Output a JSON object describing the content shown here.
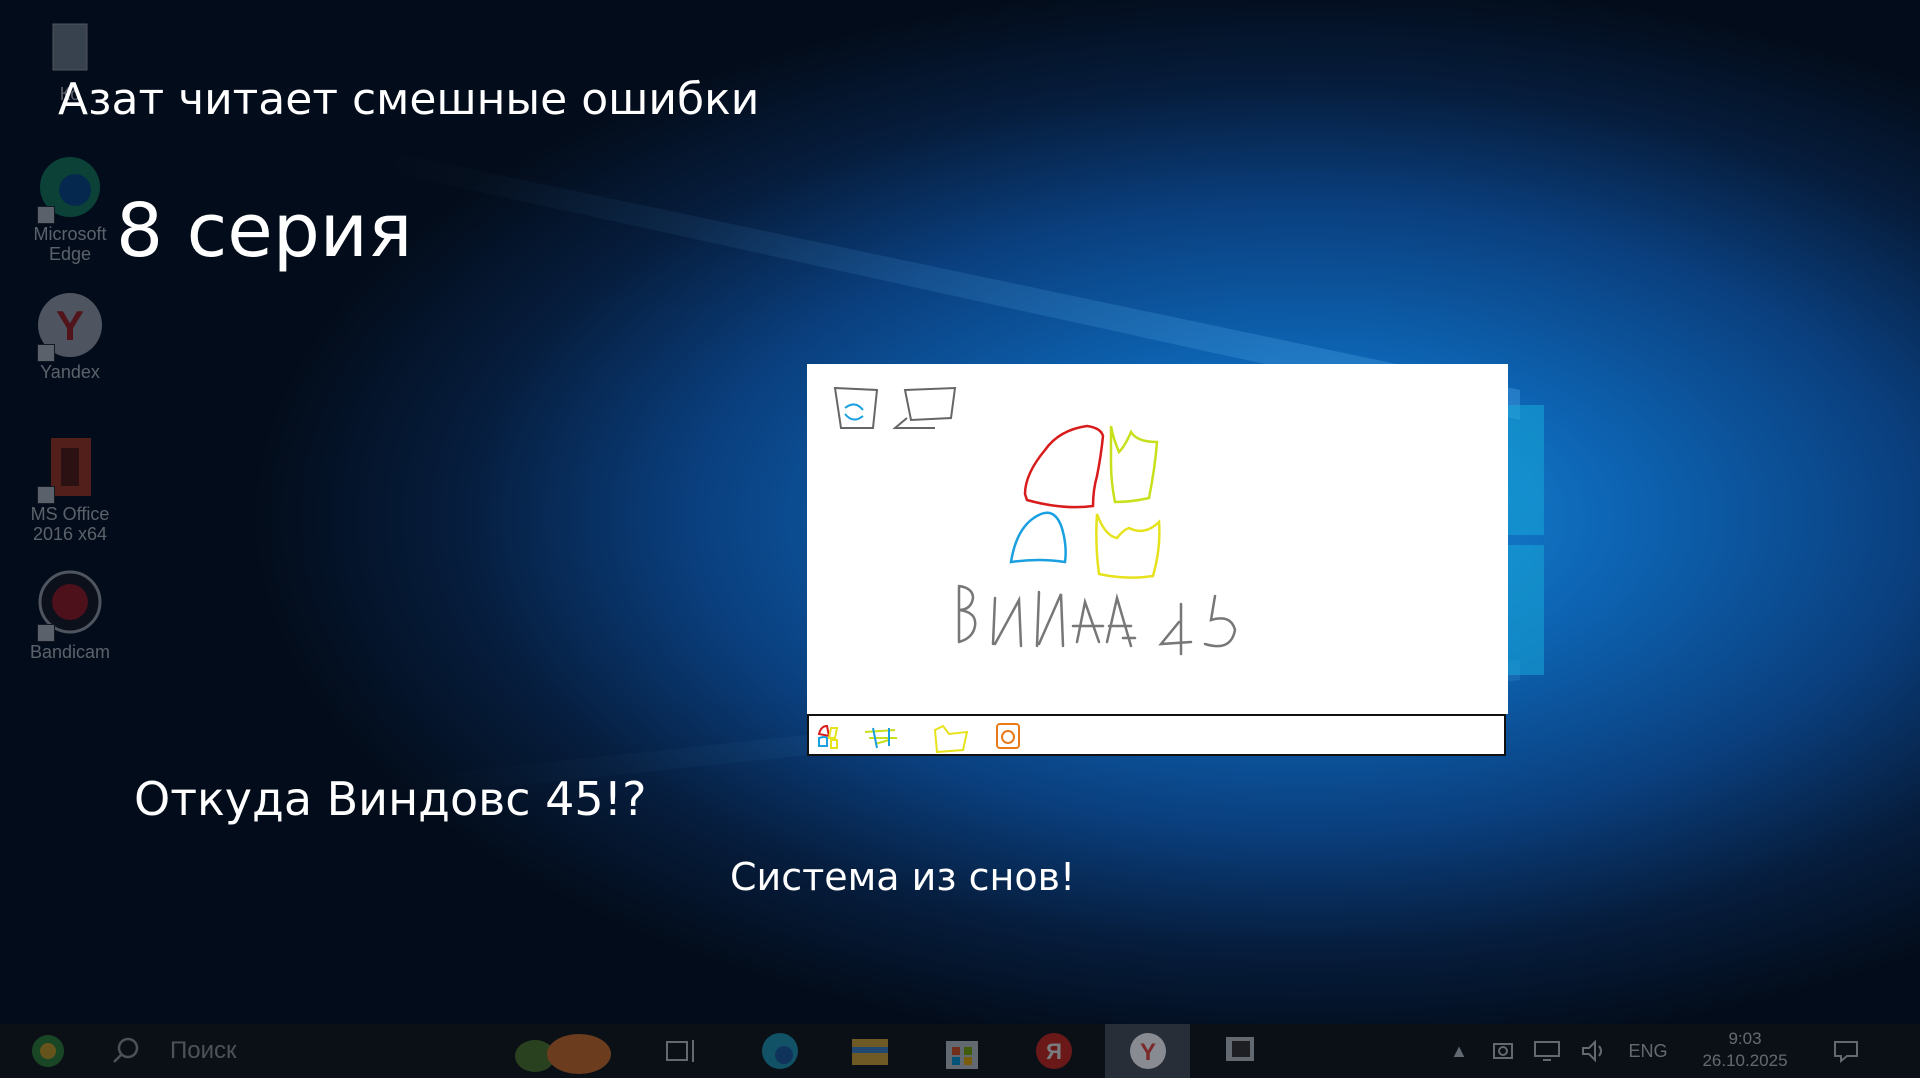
{
  "desktop": {
    "icons": [
      {
        "label": "Ко",
        "icon": "recycle-bin-icon"
      },
      {
        "label": "Microsoft Edge",
        "icon": "edge-icon"
      },
      {
        "label": "Yandex",
        "icon": "yandex-browser-icon"
      },
      {
        "label": "MS Office 2016 x64",
        "icon": "office-icon"
      },
      {
        "label": "Bandicam",
        "icon": "bandicam-icon"
      }
    ]
  },
  "overlay": {
    "title": "Азат читает смешные ошибки",
    "series": "8 серия",
    "question": "Откуда Виндовс 45!?",
    "answer": "Система из снов!"
  },
  "drawing": {
    "scribble_text": "ВИНДА45"
  },
  "taskbar": {
    "search_label": "Поиск",
    "language": "ENG",
    "time": "9:03",
    "date": "26.10.2025",
    "apps": [
      "task-view-icon",
      "edge-icon",
      "file-explorer-icon",
      "store-icon",
      "yandex-icon",
      "yandex-browser-icon",
      "window-icon"
    ]
  },
  "colors": {
    "accent": "#1a8fe0",
    "drawing_red": "#d81b1b",
    "drawing_yellow": "#e6e21c",
    "drawing_blue": "#1aa0e0",
    "drawing_gray": "#666666"
  }
}
